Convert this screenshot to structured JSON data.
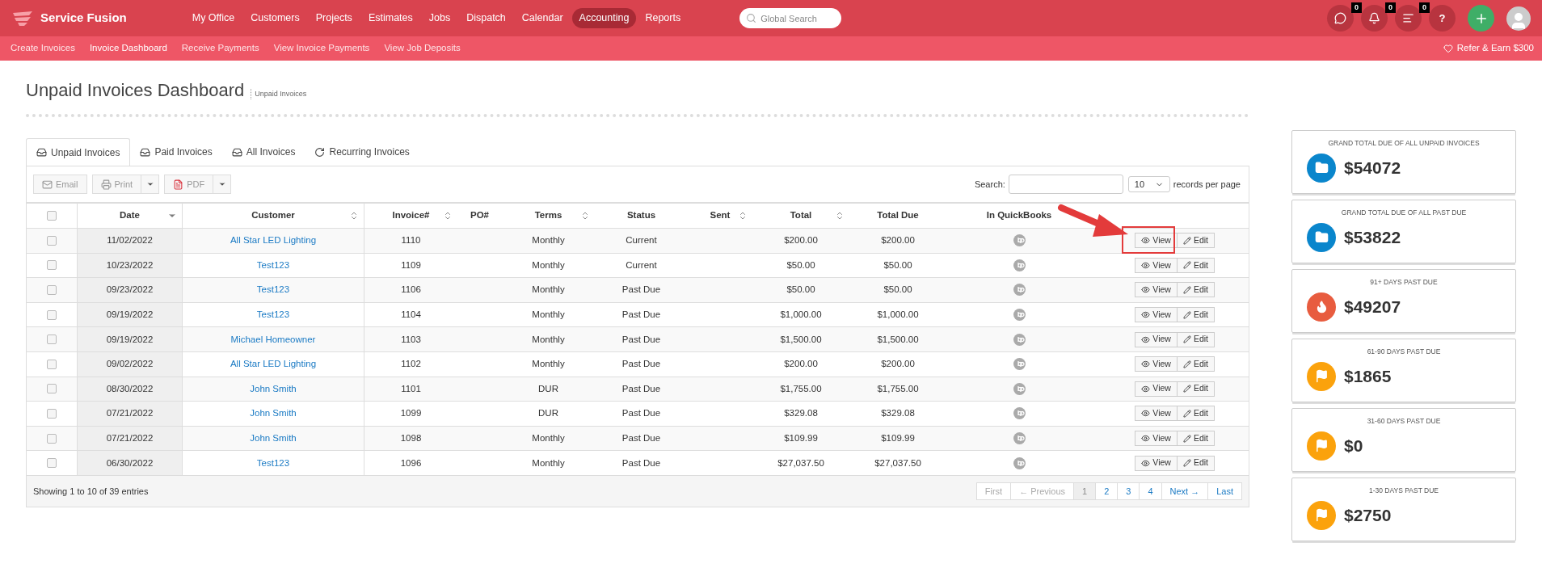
{
  "brand": "Service Fusion",
  "nav": [
    {
      "label": "My Office",
      "selected": false
    },
    {
      "label": "Customers",
      "selected": false
    },
    {
      "label": "Projects",
      "selected": false
    },
    {
      "label": "Estimates",
      "selected": false
    },
    {
      "label": "Jobs",
      "selected": false
    },
    {
      "label": "Dispatch",
      "selected": false
    },
    {
      "label": "Calendar",
      "selected": false
    },
    {
      "label": "Accounting",
      "selected": true
    },
    {
      "label": "Reports",
      "selected": false
    }
  ],
  "global_search": {
    "placeholder": "Global Search"
  },
  "header_icons": [
    {
      "kind": "chat",
      "badge": "0"
    },
    {
      "kind": "bell",
      "badge": "0"
    },
    {
      "kind": "list",
      "badge": "0"
    },
    {
      "kind": "help",
      "badge": "?"
    }
  ],
  "subnav": [
    {
      "label": "Create Invoices",
      "selected": false
    },
    {
      "label": "Invoice Dashboard",
      "selected": true
    },
    {
      "label": "Receive Payments",
      "selected": false
    },
    {
      "label": "View Invoice Payments",
      "selected": false
    },
    {
      "label": "View Job Deposits",
      "selected": false
    }
  ],
  "refer": "Refer & Earn $300",
  "page_title": "Unpaid Invoices Dashboard",
  "breadcrumb": "Unpaid Invoices",
  "tabs": [
    {
      "label": "Unpaid Invoices",
      "kind": "tray",
      "selected": true
    },
    {
      "label": "Paid Invoices",
      "kind": "tray",
      "selected": false
    },
    {
      "label": "All Invoices",
      "kind": "tray",
      "selected": false
    },
    {
      "label": "Recurring Invoices",
      "kind": "refresh",
      "selected": false
    }
  ],
  "toolbar": [
    {
      "label": "Email",
      "kind": "email"
    },
    {
      "label": "Print",
      "kind": "print"
    },
    {
      "label": "PDF",
      "kind": "pdf"
    }
  ],
  "search_label": "Search:",
  "page_size": "10",
  "page_size_label": "records per page",
  "select_all": {
    "checked": false
  },
  "columns": [
    {
      "label": "Date",
      "kind": "sorted"
    },
    {
      "label": "Customer",
      "kind": "sortable"
    },
    {
      "label": "Invoice#",
      "kind": "sortable"
    },
    {
      "label": "PO#",
      "kind": "plain"
    },
    {
      "label": "Terms",
      "kind": "sortable"
    },
    {
      "label": "Status",
      "kind": "plain"
    },
    {
      "label": "Sent",
      "kind": "sortable"
    },
    {
      "label": "Total",
      "kind": "sortable"
    },
    {
      "label": "Total Due",
      "kind": "plain"
    },
    {
      "label": "In QuickBooks",
      "kind": "plain"
    }
  ],
  "rows": [
    {
      "date": "11/02/2022",
      "customer": "All Star LED Lighting",
      "invoice": "1110",
      "terms": "Monthly",
      "status": "Current",
      "total": "$200.00",
      "total_due": "$200.00",
      "checked": false,
      "highlighted": true
    },
    {
      "date": "10/23/2022",
      "customer": "Test123",
      "invoice": "1109",
      "terms": "Monthly",
      "status": "Current",
      "total": "$50.00",
      "total_due": "$50.00",
      "checked": false,
      "highlighted": false
    },
    {
      "date": "09/23/2022",
      "customer": "Test123",
      "invoice": "1106",
      "terms": "Monthly",
      "status": "Past Due",
      "total": "$50.00",
      "total_due": "$50.00",
      "checked": false,
      "highlighted": false
    },
    {
      "date": "09/19/2022",
      "customer": "Test123",
      "invoice": "1104",
      "terms": "Monthly",
      "status": "Past Due",
      "total": "$1,000.00",
      "total_due": "$1,000.00",
      "checked": false,
      "highlighted": false
    },
    {
      "date": "09/19/2022",
      "customer": "Michael Homeowner",
      "invoice": "1103",
      "terms": "Monthly",
      "status": "Past Due",
      "total": "$1,500.00",
      "total_due": "$1,500.00",
      "checked": false,
      "highlighted": false
    },
    {
      "date": "09/02/2022",
      "customer": "All Star LED Lighting",
      "invoice": "1102",
      "terms": "Monthly",
      "status": "Past Due",
      "total": "$200.00",
      "total_due": "$200.00",
      "checked": false,
      "highlighted": false
    },
    {
      "date": "08/30/2022",
      "customer": "John Smith",
      "invoice": "1101",
      "terms": "DUR",
      "status": "Past Due",
      "total": "$1,755.00",
      "total_due": "$1,755.00",
      "checked": false,
      "highlighted": false
    },
    {
      "date": "07/21/2022",
      "customer": "John Smith",
      "invoice": "1099",
      "terms": "DUR",
      "status": "Past Due",
      "total": "$329.08",
      "total_due": "$329.08",
      "checked": false,
      "highlighted": false
    },
    {
      "date": "07/21/2022",
      "customer": "John Smith",
      "invoice": "1098",
      "terms": "Monthly",
      "status": "Past Due",
      "total": "$109.99",
      "total_due": "$109.99",
      "checked": false,
      "highlighted": false
    },
    {
      "date": "06/30/2022",
      "customer": "Test123",
      "invoice": "1096",
      "terms": "Monthly",
      "status": "Past Due",
      "total": "$27,037.50",
      "total_due": "$27,037.50",
      "checked": false,
      "highlighted": false
    }
  ],
  "row_actions": [
    [
      "View",
      "Edit"
    ],
    [
      "View",
      "Edit"
    ],
    [
      "View",
      "Edit"
    ],
    [
      "View",
      "Edit"
    ],
    [
      "View",
      "Edit"
    ],
    [
      "View",
      "Edit"
    ],
    [
      "View",
      "Edit"
    ],
    [
      "View",
      "Edit"
    ],
    [
      "View",
      "Edit"
    ],
    [
      "View",
      "Edit"
    ]
  ],
  "footer_info": "Showing 1 to 10 of 39 entries",
  "pagination": [
    {
      "label": "First",
      "selected": false,
      "disabled": true
    },
    {
      "label": "← Previous",
      "selected": false,
      "disabled": true
    },
    {
      "label": "1",
      "selected": true,
      "disabled": false
    },
    {
      "label": "2",
      "selected": false,
      "disabled": false
    },
    {
      "label": "3",
      "selected": false,
      "disabled": false
    },
    {
      "label": "4",
      "selected": false,
      "disabled": false
    },
    {
      "label": "Next →",
      "selected": false,
      "disabled": false
    },
    {
      "label": "Last",
      "selected": false,
      "disabled": false
    }
  ],
  "summary_cards": [
    {
      "title": "GRAND TOTAL DUE OF ALL UNPAID INVOICES",
      "amount": "$54072",
      "kind": "folder",
      "color": "#0a86cc"
    },
    {
      "title": "GRAND TOTAL DUE OF ALL PAST DUE",
      "amount": "$53822",
      "kind": "folder",
      "color": "#0a86cc"
    },
    {
      "title": "91+ DAYS PAST DUE",
      "amount": "$49207",
      "kind": "fire",
      "color": "#e85c3f"
    },
    {
      "title": "61-90 DAYS PAST DUE",
      "amount": "$1865",
      "kind": "flag",
      "color": "#fba20c"
    },
    {
      "title": "31-60 DAYS PAST DUE",
      "amount": "$0",
      "kind": "flag",
      "color": "#fba20c"
    },
    {
      "title": "1-30 DAYS PAST DUE",
      "amount": "$2750",
      "kind": "flag",
      "color": "#fba20c"
    }
  ]
}
